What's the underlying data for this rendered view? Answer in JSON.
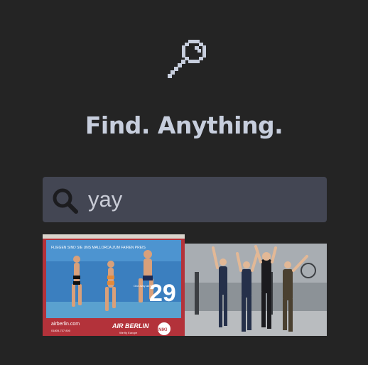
{
  "app": {
    "logo_icon": "magnifier-key-pixel-icon",
    "headline": "Find. Anything."
  },
  "search": {
    "icon": "search-icon",
    "value": "yay"
  },
  "results": [
    {
      "kind": "gif-thumbnail",
      "billboard_top_text": "FLIEGEN SIND SIE UNS MALLORCA ZUM FAIREN PREIS",
      "billboard_number": "29",
      "billboard_small": "One-Way ab €",
      "site": "airberlin.com",
      "phone": "01805-737 800",
      "brand": "AIR BERLIN",
      "slogan": "We fly Europe",
      "badge": "NIKI"
    },
    {
      "kind": "gif-thumbnail",
      "description_icon": "celebration-scene"
    }
  ],
  "colors": {
    "background": "#242424",
    "headline": "#c7cedd",
    "search_bg": "#434653",
    "search_text": "#c9ccd6"
  }
}
